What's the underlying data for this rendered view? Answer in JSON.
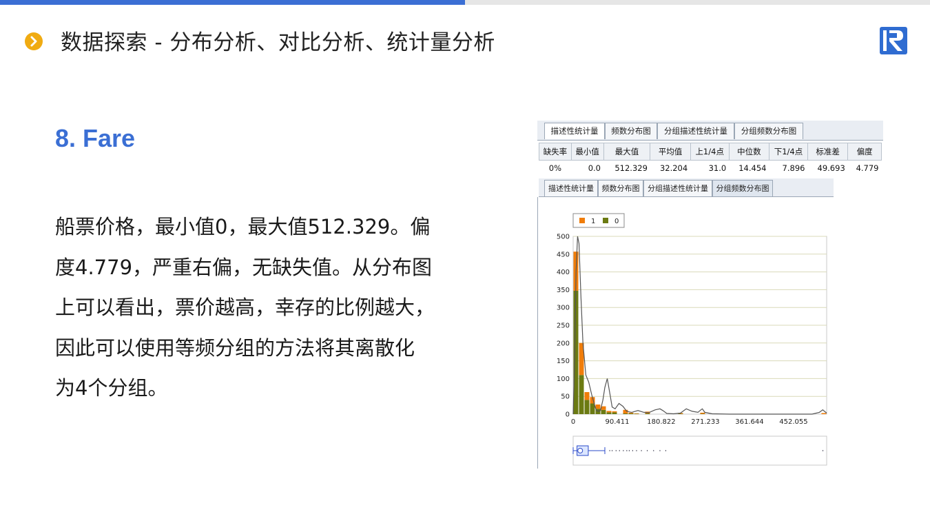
{
  "header": {
    "title": "数据探索 - 分布分析、对比分析、统计量分析",
    "bullet_icon": "chevron-right-icon",
    "logo_icon": "r-logo-icon",
    "colors": {
      "accent": "#3b6fd4",
      "bullet": "#f0ab12"
    }
  },
  "section": {
    "title": "8. Fare",
    "paragraph_lines": [
      "船票价格，最小值0，最大值512.329。偏",
      "度4.779，严重右偏，无缺失值。从分布图",
      "上可以看出，票价越高，幸存的比例越大，",
      "因此可以使用等频分组的方法将其离散化",
      "为4个分组。"
    ]
  },
  "screenshot": {
    "tabs_top": [
      "描述性统计量",
      "频数分布图",
      "分组描述性统计量",
      "分组频数分布图"
    ],
    "stats_headers": [
      "缺失率",
      "最小值",
      "最大值",
      "平均值",
      "上1/4点",
      "中位数",
      "下1/4点",
      "标准差",
      "偏度"
    ],
    "stats_values": [
      "0%",
      "0.0",
      "512.329",
      "32.204",
      "31.0",
      "14.454",
      "7.896",
      "49.693",
      "4.779"
    ],
    "tabs_bottom": [
      "描述性统计量",
      "频数分布图",
      "分组描述性统计量",
      "分组频数分布图"
    ]
  },
  "chart_data": {
    "type": "bar",
    "stacked": true,
    "legend": [
      "1",
      "0"
    ],
    "legend_position": "top-left",
    "colors": {
      "1": "#f07d0a",
      "0": "#6b7a12",
      "density": "#555555"
    },
    "x_tick_labels": [
      "0",
      "90.411",
      "180.822",
      "271.233",
      "361.644",
      "452.055"
    ],
    "x_ticks": [
      0,
      90.411,
      180.822,
      271.233,
      361.644,
      452.055
    ],
    "xlim": [
      0,
      520
    ],
    "y_tick_labels": [
      "0",
      "50",
      "100",
      "150",
      "200",
      "250",
      "300",
      "350",
      "400",
      "450",
      "500"
    ],
    "ylim": [
      0,
      500
    ],
    "grid": true,
    "bin_width": 11.3,
    "bin_starts": [
      0,
      11.3,
      22.6,
      33.9,
      45.2,
      56.5,
      67.8,
      79.1,
      101.7,
      113.0,
      124.3,
      146.9,
      214.7,
      259.9,
      508.6
    ],
    "series": [
      {
        "name": "0",
        "values": [
          347,
          110,
          40,
          30,
          15,
          12,
          5,
          5,
          2,
          2,
          1,
          2,
          1,
          1,
          0
        ]
      },
      {
        "name": "1",
        "values": [
          110,
          90,
          22,
          18,
          12,
          10,
          4,
          3,
          10,
          2,
          1,
          5,
          2,
          3,
          3
        ]
      }
    ],
    "density_curve": [
      [
        0,
        0
      ],
      [
        3,
        150
      ],
      [
        6,
        400
      ],
      [
        9,
        500
      ],
      [
        12,
        480
      ],
      [
        16,
        330
      ],
      [
        20,
        200
      ],
      [
        26,
        110
      ],
      [
        32,
        90
      ],
      [
        38,
        55
      ],
      [
        43,
        30
      ],
      [
        47,
        12
      ],
      [
        51,
        8
      ],
      [
        56,
        10
      ],
      [
        61,
        40
      ],
      [
        65,
        75
      ],
      [
        70,
        100
      ],
      [
        75,
        60
      ],
      [
        80,
        20
      ],
      [
        86,
        15
      ],
      [
        94,
        30
      ],
      [
        102,
        22
      ],
      [
        110,
        8
      ],
      [
        120,
        5
      ],
      [
        133,
        10
      ],
      [
        145,
        5
      ],
      [
        155,
        4
      ],
      [
        168,
        12
      ],
      [
        178,
        15
      ],
      [
        184,
        10
      ],
      [
        192,
        2
      ],
      [
        206,
        1
      ],
      [
        220,
        3
      ],
      [
        232,
        15
      ],
      [
        244,
        8
      ],
      [
        256,
        5
      ],
      [
        262,
        12
      ],
      [
        265,
        15
      ],
      [
        270,
        5
      ],
      [
        285,
        1
      ],
      [
        320,
        0
      ],
      [
        400,
        0
      ],
      [
        490,
        0
      ],
      [
        505,
        5
      ],
      [
        512,
        12
      ],
      [
        520,
        3
      ]
    ],
    "boxplot": {
      "min": 0,
      "q1": 7.896,
      "median": 14.454,
      "q3": 31.0,
      "whisker_high": 65.0
    }
  }
}
